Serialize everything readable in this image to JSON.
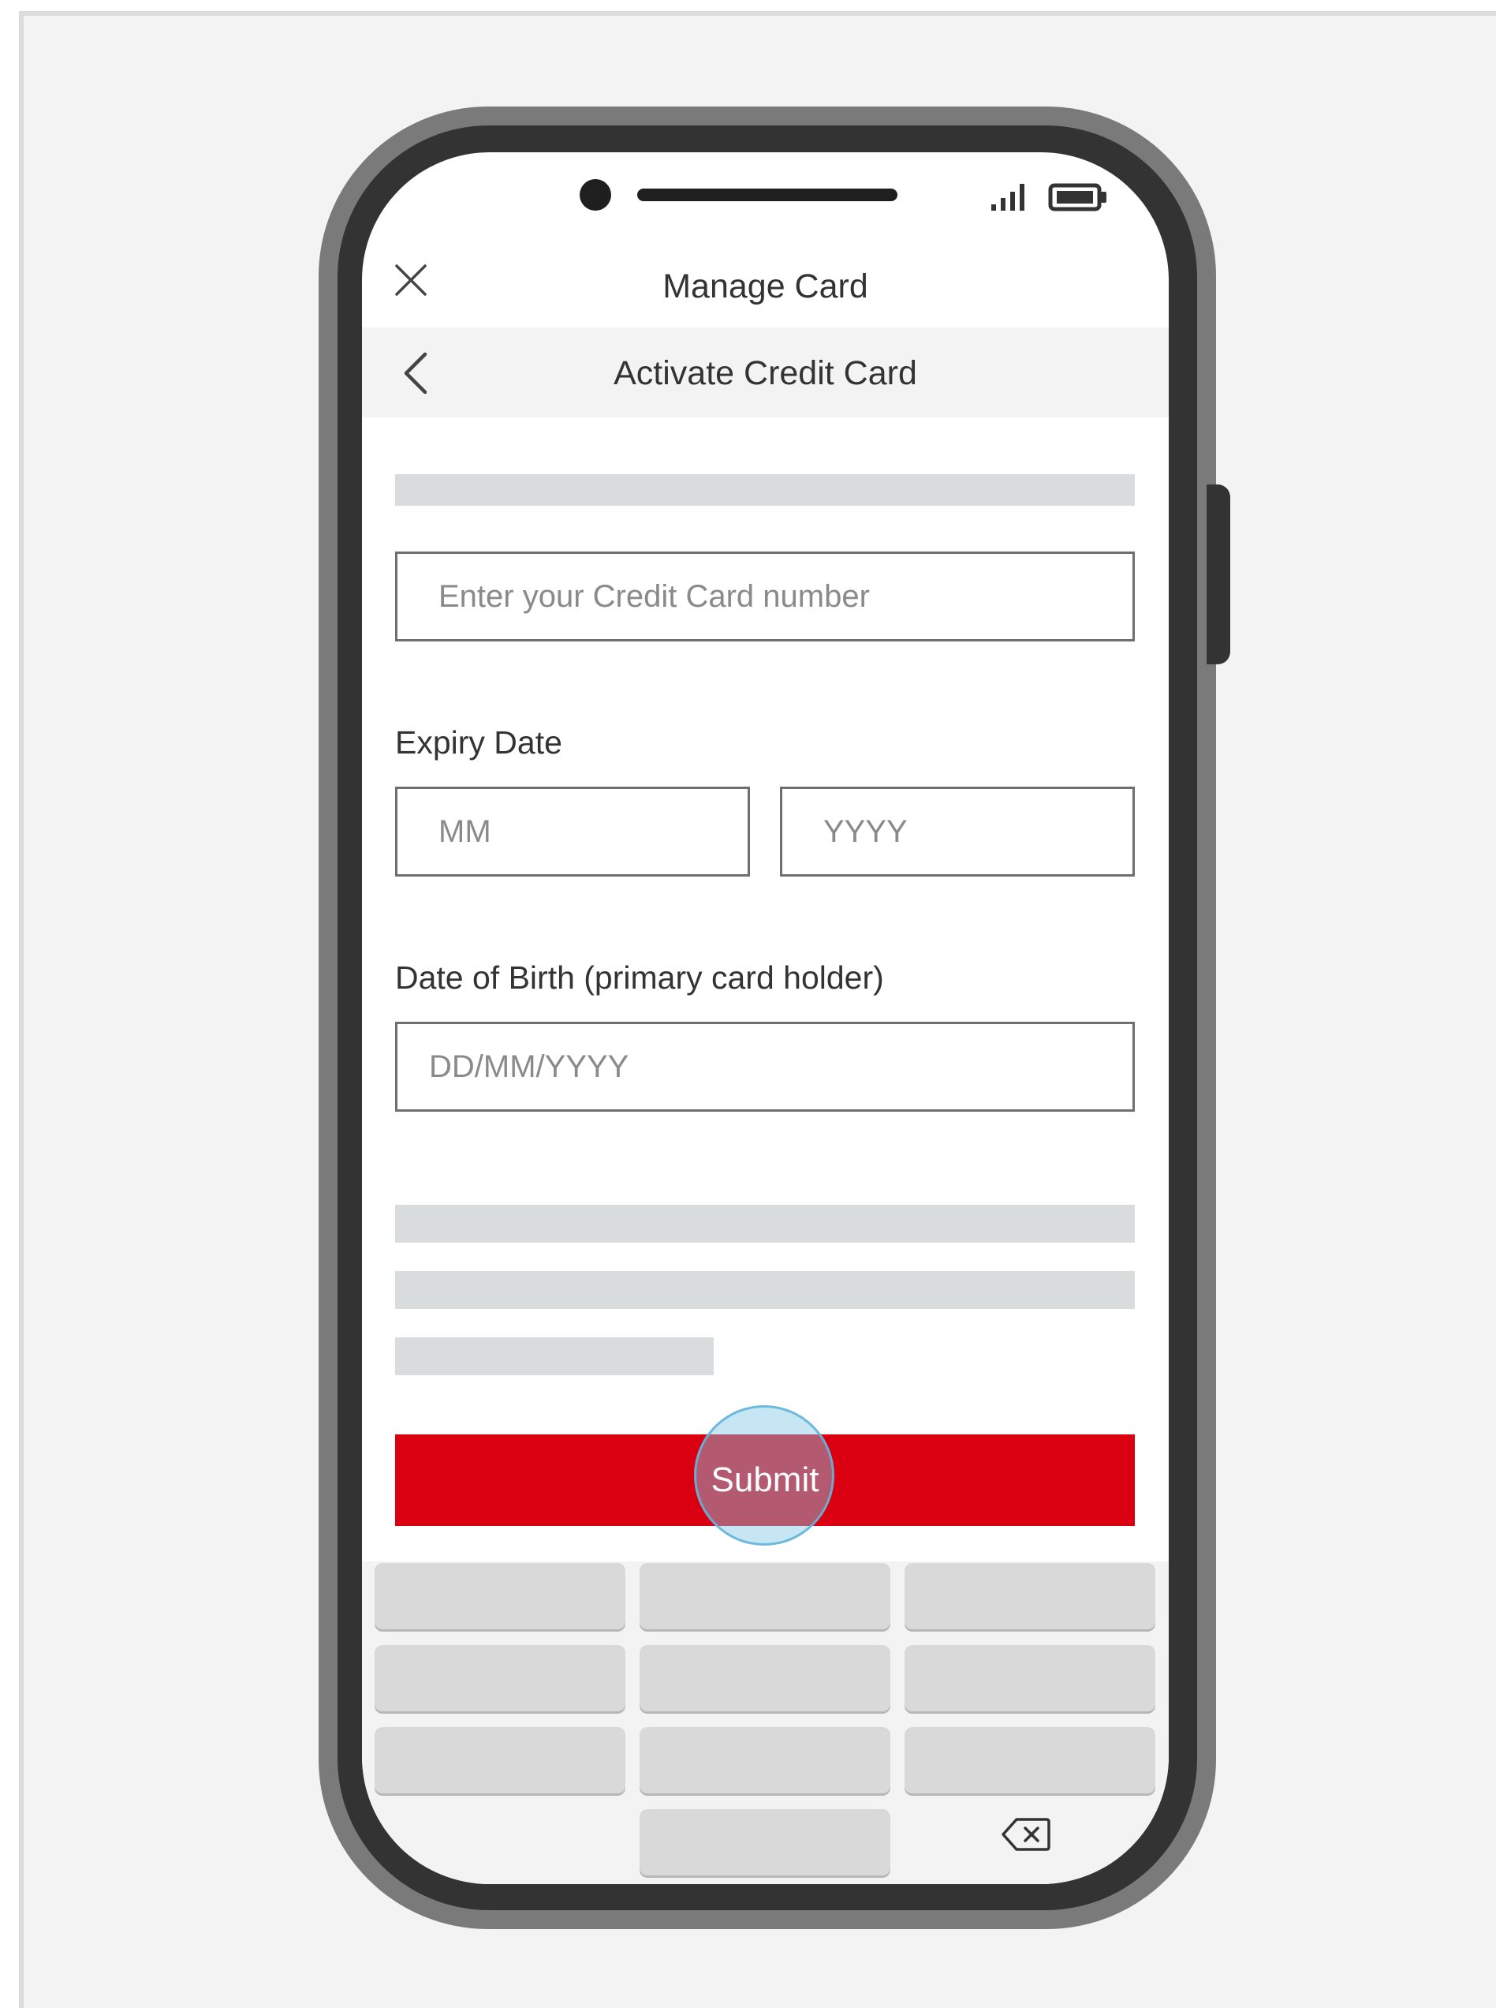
{
  "header": {
    "title": "Manage Card",
    "close_icon": "close-icon"
  },
  "subheader": {
    "title": "Activate Credit Card",
    "back_icon": "chevron-left-icon"
  },
  "form": {
    "card_number": {
      "placeholder": "Enter your Credit Card number",
      "value": ""
    },
    "expiry": {
      "label": "Expiry Date",
      "month": {
        "placeholder": "MM",
        "value": ""
      },
      "year": {
        "placeholder": "YYYY",
        "value": ""
      }
    },
    "dob": {
      "label": "Date of Birth (primary card holder)",
      "placeholder": "DD/MM/YYYY",
      "value": ""
    },
    "submit_label": "Submit"
  },
  "colors": {
    "accent": "#db0011",
    "tap_indicator": "#82c8e6",
    "skeleton": "#d9dcdd"
  },
  "status_bar": {
    "icons": [
      "camera",
      "speaker",
      "signal-icon",
      "battery-icon"
    ]
  },
  "keypad": {
    "backspace_icon": "backspace-icon"
  }
}
